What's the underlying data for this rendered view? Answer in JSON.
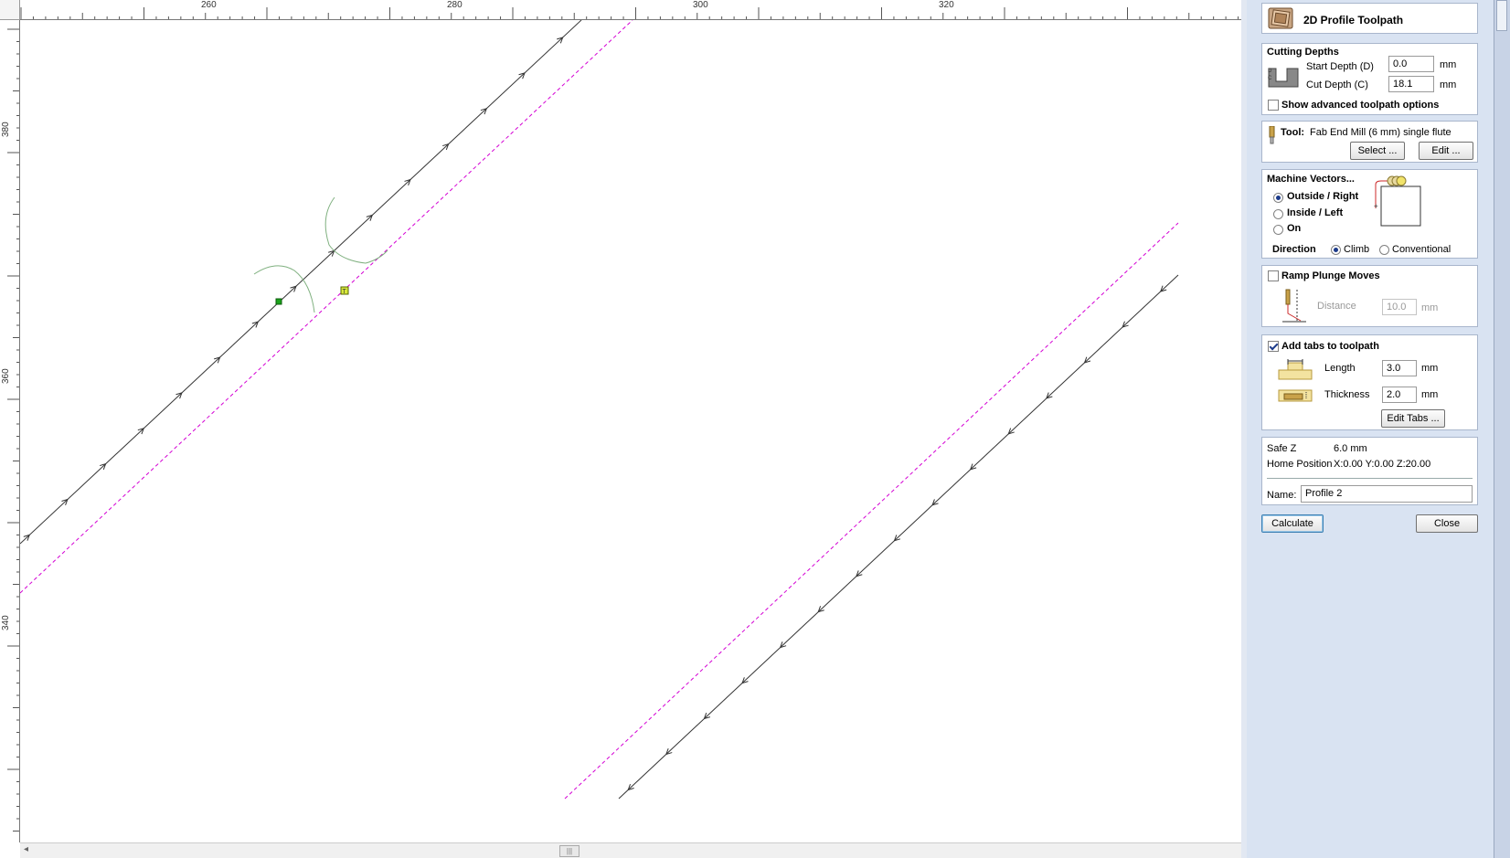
{
  "ruler": {
    "top_labels": [
      "260",
      "280",
      "300",
      "320"
    ],
    "left_labels": [
      "380",
      "360",
      "340"
    ]
  },
  "panel": {
    "title": "2D Profile Toolpath",
    "cutting_depths": {
      "heading": "Cutting Depths",
      "start_depth_label": "Start Depth (D)",
      "start_depth_value": "0.0",
      "cut_depth_label": "Cut Depth (C)",
      "cut_depth_value": "18.1",
      "unit": "mm",
      "advanced_label": "Show advanced toolpath options",
      "advanced_checked": false
    },
    "tool": {
      "label": "Tool:",
      "name": "Fab End Mill (6 mm) single flute",
      "select_label": "Select ...",
      "edit_label": "Edit ..."
    },
    "machine_vectors": {
      "heading": "Machine Vectors...",
      "options": [
        "Outside / Right",
        "Inside / Left",
        "On"
      ],
      "selected": "Outside / Right",
      "direction_label": "Direction",
      "direction_options": [
        "Climb",
        "Conventional"
      ],
      "direction_selected": "Climb"
    },
    "ramp": {
      "label": "Ramp Plunge Moves",
      "checked": false,
      "distance_label": "Distance",
      "distance_value": "10.0",
      "unit": "mm"
    },
    "tabs": {
      "label": "Add tabs to toolpath",
      "checked": true,
      "length_label": "Length",
      "length_value": "3.0",
      "thickness_label": "Thickness",
      "thickness_value": "2.0",
      "unit": "mm",
      "edit_tabs_label": "Edit Tabs ..."
    },
    "info": {
      "safe_z_label": "Safe Z",
      "safe_z_value": "6.0 mm",
      "home_label": "Home Position",
      "home_value": "X:0.00 Y:0.00 Z:20.00",
      "name_label": "Name:",
      "name_value": "Profile 2"
    },
    "calculate_label": "Calculate",
    "close_label": "Close"
  },
  "colors": {
    "panel_bg": "#d9e3f2",
    "toolpath_offset": "#d400d4",
    "vector_line": "#222222",
    "tab_marker": "#d8e83a",
    "node_marker": "#1aa31a"
  }
}
